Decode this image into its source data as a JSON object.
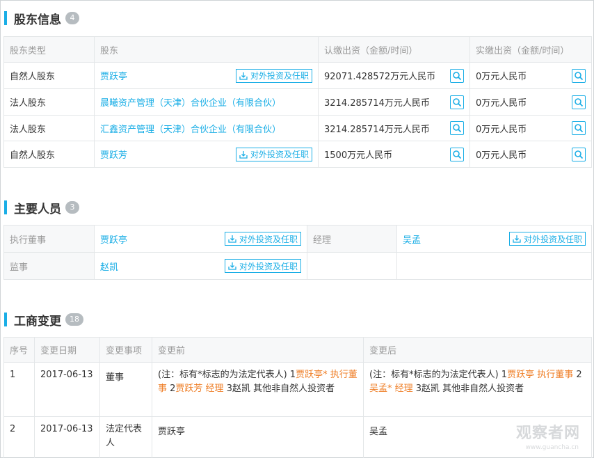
{
  "shareholders": {
    "title": "股东信息",
    "count": "4",
    "headers": [
      "股东类型",
      "股东",
      "认缴出资（金额/时间）",
      "实缴出资（金额/时间）"
    ],
    "rows": [
      {
        "type": "自然人股东",
        "name": "贾跃亭",
        "has_button": true,
        "subscribed": "92071.428572万元人民币",
        "paid": "0万元人民币"
      },
      {
        "type": "法人股东",
        "name": "晨曦资产管理（天津）合伙企业（有限合伙）",
        "has_button": false,
        "subscribed": "3214.285714万元人民币",
        "paid": "0万元人民币"
      },
      {
        "type": "法人股东",
        "name": "汇鑫资产管理（天津）合伙企业（有限合伙）",
        "has_button": false,
        "subscribed": "3214.285714万元人民币",
        "paid": "0万元人民币"
      },
      {
        "type": "自然人股东",
        "name": "贾跃芳",
        "has_button": true,
        "subscribed": "1500万元人民币",
        "paid": "0万元人民币"
      }
    ],
    "invest_button_label": "对外投资及任职"
  },
  "personnel": {
    "title": "主要人员",
    "count": "3",
    "rows": [
      {
        "role1": "执行董事",
        "name1": "贾跃亭",
        "role2": "经理",
        "name2": "吴孟"
      },
      {
        "role1": "监事",
        "name1": "赵凯",
        "role2": "",
        "name2": ""
      }
    ],
    "invest_button_label": "对外投资及任职"
  },
  "changes": {
    "title": "工商变更",
    "count": "18",
    "headers": [
      "序号",
      "变更日期",
      "变更事项",
      "变更前",
      "变更后"
    ],
    "rows": [
      {
        "no": "1",
        "date": "2017-06-13",
        "item": "董事",
        "before": [
          {
            "t": "(注：标有*标志的为法定代表人) 1",
            "c": ""
          },
          {
            "t": "贾跃亭* 执行董事",
            "c": "orange"
          },
          {
            "t": " 2",
            "c": ""
          },
          {
            "t": "贾跃芳 经理",
            "c": "orange"
          },
          {
            "t": " 3赵凯 其他非自然人投资者",
            "c": ""
          }
        ],
        "after": [
          {
            "t": "(注：标有*标志的为法定代表人) 1",
            "c": ""
          },
          {
            "t": "贾跃亭 执行董事",
            "c": "orange"
          },
          {
            "t": " 2",
            "c": ""
          },
          {
            "t": "吴孟* 经理",
            "c": "orange"
          },
          {
            "t": " 3赵凯 其他非自然人投资者",
            "c": ""
          }
        ]
      },
      {
        "no": "2",
        "date": "2017-06-13",
        "item": "法定代表人",
        "before": [
          {
            "t": "贾跃亭",
            "c": ""
          }
        ],
        "after": [
          {
            "t": "吴孟",
            "c": ""
          }
        ]
      }
    ]
  },
  "watermark": {
    "main": "观察者网",
    "sub": "www.guancha.cn"
  },
  "colors": {
    "accent": "#1aaee6",
    "orange": "#ef7e26",
    "muted": "#999999",
    "badge": "#b6bcc0"
  }
}
